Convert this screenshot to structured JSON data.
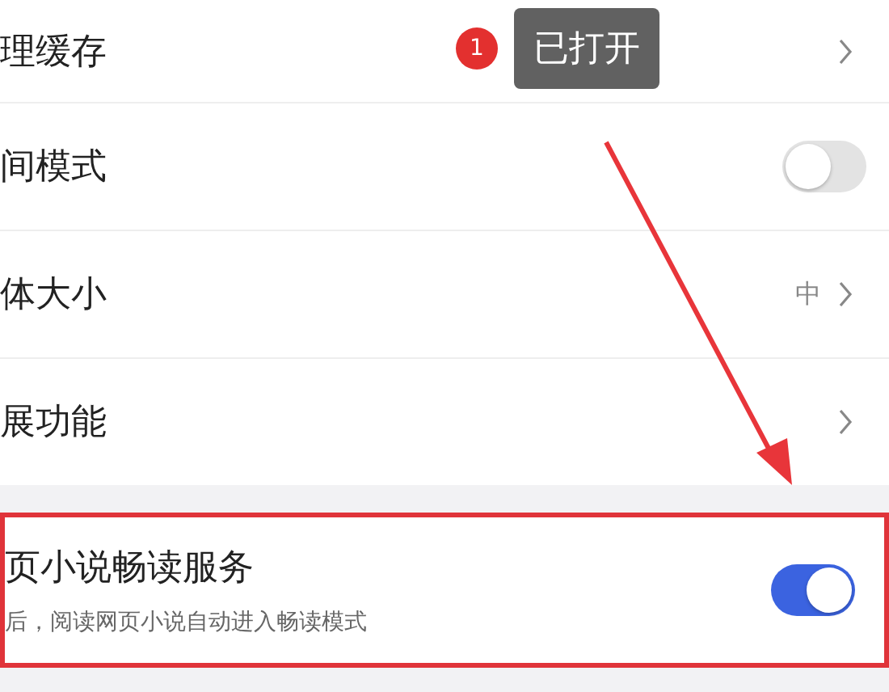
{
  "settings": [
    {
      "kind": "chevron",
      "label": "理缓存"
    },
    {
      "kind": "toggle",
      "label": "间模式",
      "on": false
    },
    {
      "kind": "value",
      "label": "体大小",
      "value": "中"
    },
    {
      "kind": "chevron",
      "label": "展功能"
    }
  ],
  "reader_service": {
    "title": "页小说畅读服务",
    "description": "后，阅读网页小说自动进入畅读模式",
    "on": true,
    "highlighted": true
  },
  "callout": {
    "badge": "1",
    "text": "已打开"
  }
}
